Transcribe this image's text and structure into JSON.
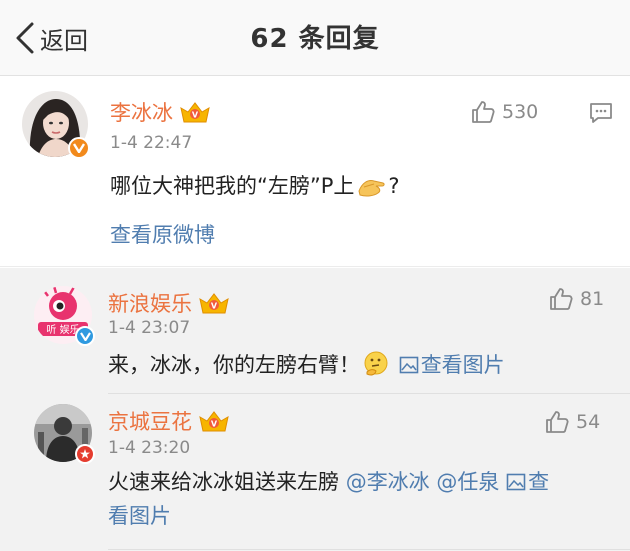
{
  "header": {
    "back_label": "返回",
    "title": "62 条回复"
  },
  "main_post": {
    "user": "李冰冰",
    "time": "1-4 22:47",
    "likes": "530",
    "text_before": "哪位大神把我的“左膀”P上",
    "text_after": "?",
    "emoji": "hands-emoji",
    "view_original": "查看原微博"
  },
  "replies": [
    {
      "user": "新浪娱乐",
      "time": "1-4 23:07",
      "likes": "81",
      "text": "来，冰冰，你的左膀右臂！",
      "emoji": "thinking-emoji",
      "view_image": "查看图片"
    },
    {
      "user": "京城豆花",
      "time": "1-4 23:20",
      "likes": "54",
      "text": "火速来给冰冰姐送来左膀 ",
      "mention_1": "@李冰冰",
      "mention_2": "@任泉",
      "view_image_part1": "查",
      "view_image_part2": "看图片"
    }
  ],
  "colors": {
    "username": "#eb7340",
    "link": "#507daf",
    "meta": "#8a8a8a",
    "verified_orange": "#f28a1c",
    "verified_blue": "#2f9ae0",
    "verified_red": "#e53c2f"
  },
  "icons": [
    "chevron-left-icon",
    "thumbs-up-icon",
    "comment-icon",
    "crown-icon",
    "image-icon",
    "verified-badge-icon"
  ]
}
